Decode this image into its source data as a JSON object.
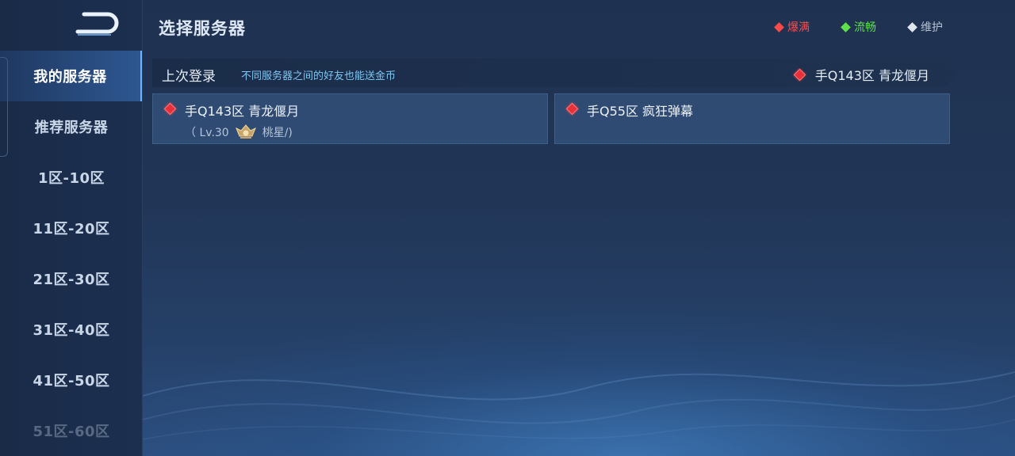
{
  "header": {
    "title": "选择服务器",
    "legend": [
      {
        "label": "爆满",
        "color": "#ff4a4a"
      },
      {
        "label": "流畅",
        "color": "#5de04a"
      },
      {
        "label": "维护",
        "color": "#b6c2d2"
      }
    ]
  },
  "sidebar": {
    "items": [
      {
        "label": "我的服务器",
        "active": true
      },
      {
        "label": "推荐服务器"
      },
      {
        "label": "1区-10区"
      },
      {
        "label": "11区-20区"
      },
      {
        "label": "21区-30区"
      },
      {
        "label": "31区-40区"
      },
      {
        "label": "41区-50区"
      },
      {
        "label": "51区-60区"
      }
    ]
  },
  "last_login": {
    "label": "上次登录",
    "hint": "不同服务器之间的好友也能送金币",
    "server": "手Q143区 青龙偃月"
  },
  "servers": [
    {
      "name": "手Q143区 青龙偃月",
      "status": "爆满",
      "level": "（ Lv.30",
      "player": "桃星/)"
    },
    {
      "name": "手Q55区 疯狂弹幕",
      "status": "爆满"
    }
  ],
  "colors": {
    "full": "#e8303a",
    "smooth": "#5de04a",
    "maintain": "#b6c2d2",
    "accent": "#6fb6ff"
  }
}
